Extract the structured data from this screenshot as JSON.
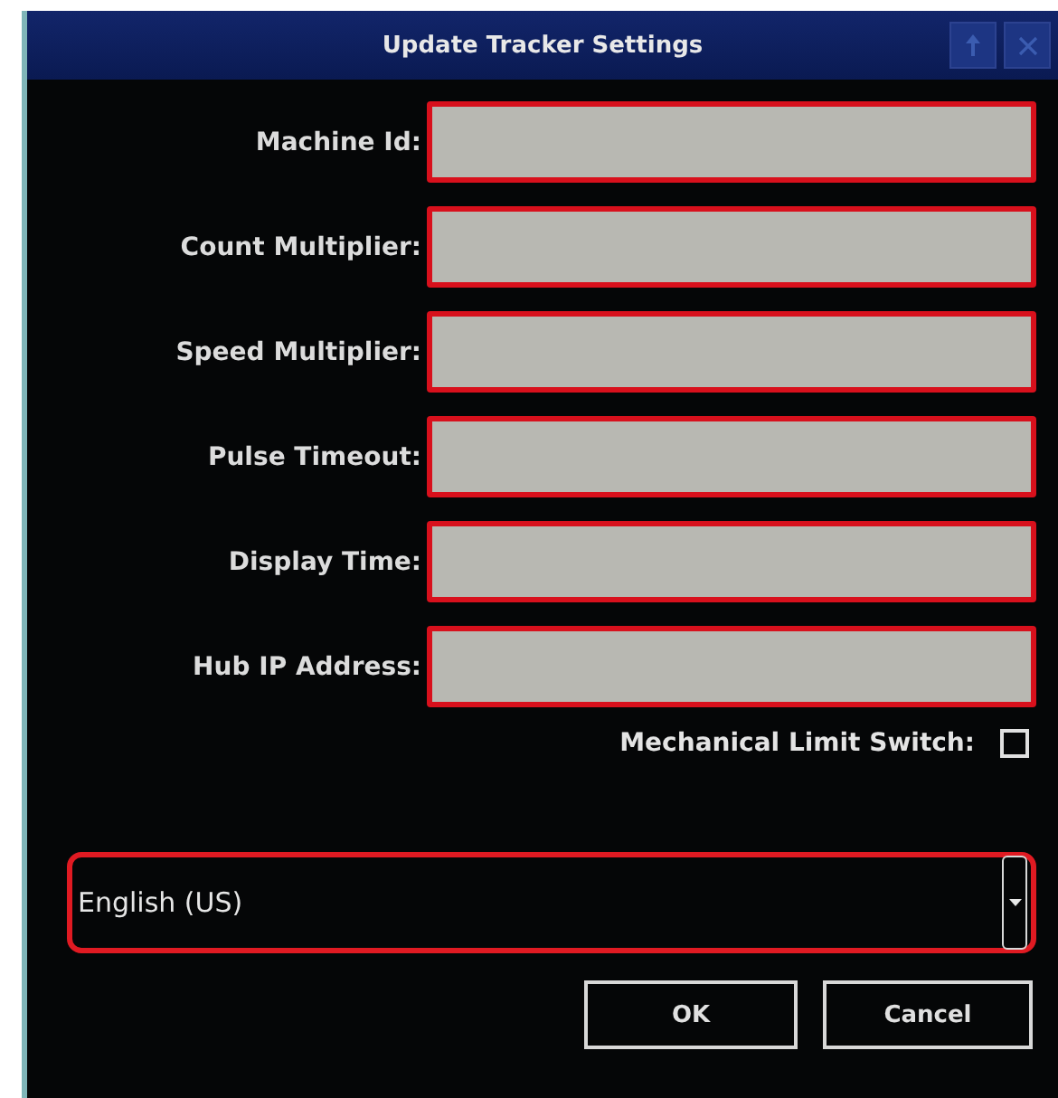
{
  "window": {
    "title": "Update Tracker Settings"
  },
  "fields": [
    {
      "label": "Machine Id:"
    },
    {
      "label": "Count Multiplier:"
    },
    {
      "label": "Speed Multiplier:"
    },
    {
      "label": "Pulse Timeout:"
    },
    {
      "label": "Display Time:"
    },
    {
      "label": "Hub IP Address:"
    }
  ],
  "option": {
    "label": "Mechanical Limit Switch:",
    "checked": false
  },
  "language": {
    "value": "English (US)"
  },
  "buttons": [
    "OK",
    "Cancel"
  ]
}
